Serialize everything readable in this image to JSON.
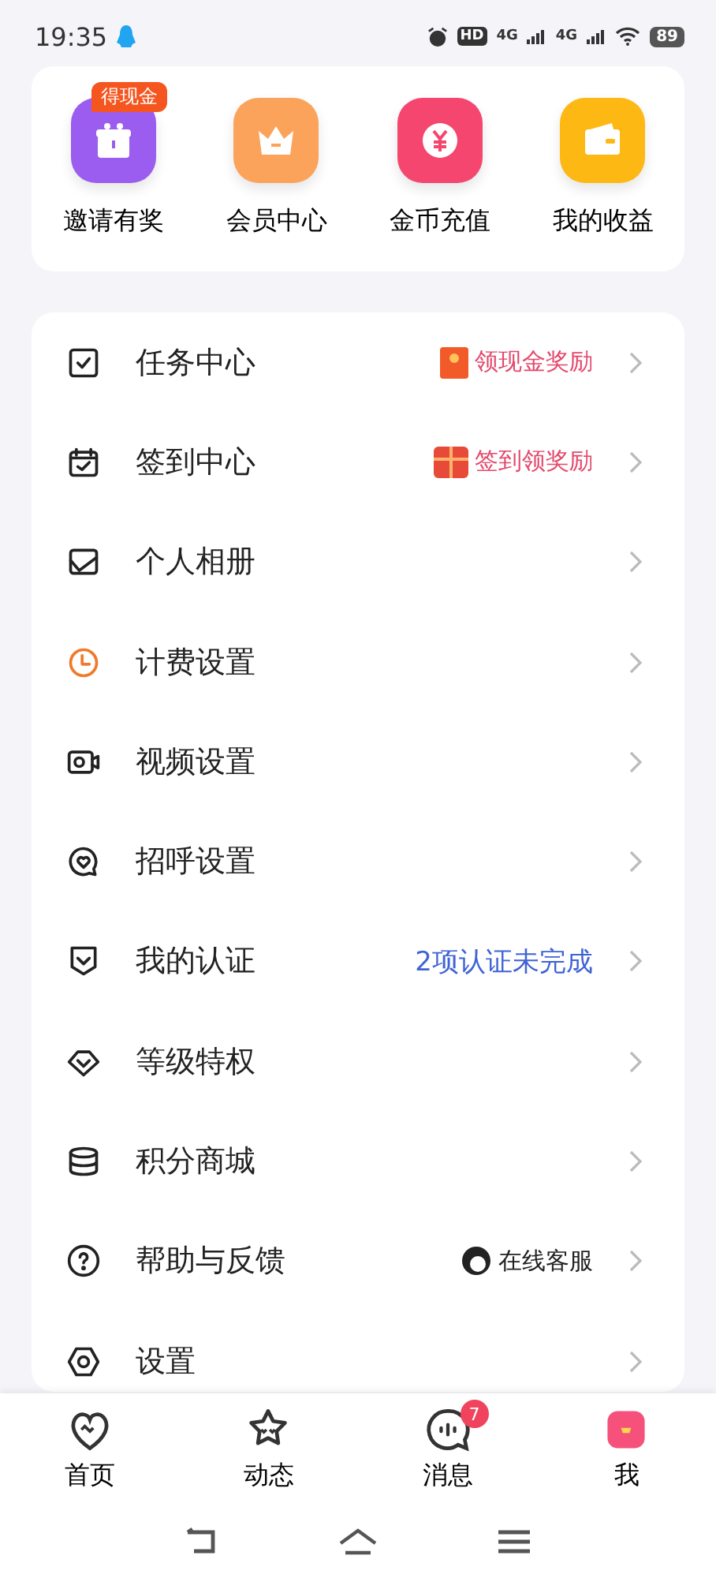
{
  "status_bar": {
    "time": "19:35",
    "hd": "HD",
    "networks": [
      "4G",
      "4G"
    ],
    "battery": "89"
  },
  "shortcuts": [
    {
      "label": "邀请有奖",
      "badge": "得现金",
      "color": "#9b5cf0"
    },
    {
      "label": "会员中心",
      "color": "#fba35a"
    },
    {
      "label": "金币充值",
      "color": "#f4466e"
    },
    {
      "label": "我的收益",
      "color": "#fdb813"
    }
  ],
  "menu": [
    {
      "label": "任务中心",
      "extra": {
        "kind": "envelope",
        "text": "领现金奖励"
      }
    },
    {
      "label": "签到中心",
      "extra": {
        "kind": "gift",
        "text": "签到领奖励"
      }
    },
    {
      "label": "个人相册"
    },
    {
      "label": "计费设置"
    },
    {
      "label": "视频设置"
    },
    {
      "label": "招呼设置"
    },
    {
      "label": "我的认证",
      "extra": {
        "kind": "status",
        "text": "2项认证未完成"
      }
    },
    {
      "label": "等级特权"
    },
    {
      "label": "积分商城"
    },
    {
      "label": "帮助与反馈",
      "extra": {
        "kind": "service",
        "text": "在线客服"
      }
    },
    {
      "label": "设置"
    }
  ],
  "tab_bar": [
    {
      "label": "首页",
      "selected": false
    },
    {
      "label": "动态",
      "selected": false
    },
    {
      "label": "消息",
      "selected": false,
      "badge": "7"
    },
    {
      "label": "我",
      "selected": true
    }
  ]
}
